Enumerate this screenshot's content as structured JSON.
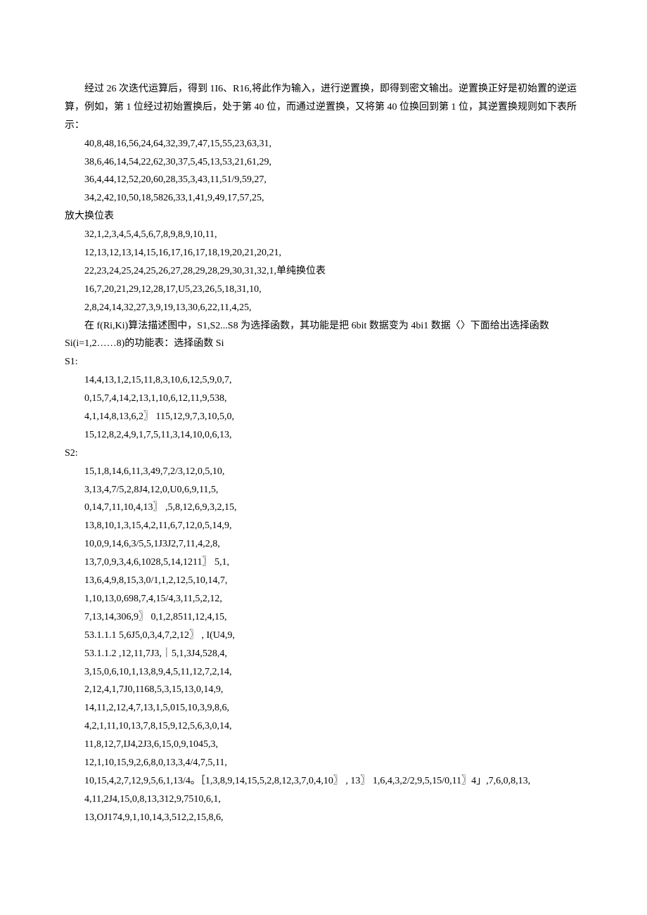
{
  "p1": "经过 26 次迭代运算后，得到 1I6、R16,将此作为输入，进行逆置换，即得到密文输出。逆置换正好是初始置的逆运算，例如，第 1 位经过初始置换后，处于第 40 位，而通过逆置换，又将第 40 位换回到第 1 位，其逆置换规则如下表所示：",
  "l1": "40,8,48,16,56,24,64,32,39,7,47,15,55,23,63,31,",
  "l2": "38,6,46,14,54,22,62,30,37,5,45,13,53,21,61,29,",
  "l3": "36,4,44,12,52,20,60,28,35,3,43,11,51/9,59,27,",
  "l4": "34,2,42,10,50,18,5826,33,1,41,9,49,17,57,25,",
  "h1": "放大换位表",
  "l5": "32,1,2,3,4,5,4,5,6,7,8,9,8,9,10,11,",
  "l6": "12,13,12,13,14,15,16,17,16,17,18,19,20,21,20,21,",
  "l7": "22,23,24,25,24,25,26,27,28,29,28,29,30,31,32,1,单纯换位表",
  "l8": "16,7,20,21,29,12,28,17,U5,23,26,5,18,31,10,",
  "l9": "2,8,24,14,32,27,3,9,19,13,30,6,22,11,4,25,",
  "p2": "在 f(Ri,Ki)算法描述图中，S1,S2...S8 为选择函数，其功能是把 6bit 数据变为 4bi1 数据〈〉下面给出选择函数 Si(i=1,2……8)的功能表：选择函数 Si",
  "hS1": "S1:",
  "s1a": "14,4,13,1,2,15,11,8,3,10,6,12,5,9,0,7,",
  "s1b": "0,15,7,4,14,2,13,1,10,6,12,11,9,538,",
  "s1c": "4,1,14,8,13,6,2〗 115,12,9,7,3,10,5,0,",
  "s1d": "15,12,8,2,4,9,1,7,5,11,3,14,10,0,6,13,",
  "hS2": "S2:",
  "s2a": "15,1,8,14,6,11,3,49,7,2/3,12,0,5,10,",
  "s2b": "3,13,4,7/5,2,8J4,12,0,U0,6,9,11,5,",
  "s2c": "0,14,7,11,10,4,13〗 ,5,8,12,6,9,3,2,15,",
  "s2d": "13,8,10,1,3,15,4,2,11,6,7,12,0,5,14,9,",
  "s2e": "10,0,9,14,6,3/5,5,1J3J2,7,11,4,2,8,",
  "s2f": "13,7,0,9,3,4,6,1028,5,14,1211〗 5,1,",
  "s2g": "13,6,4,9,8,15,3,0/1,1,2,12,5,10,14,7,",
  "s2h": "1,10,13,0,698,7,4,15/4,3,11,5,2,12,",
  "s2i": "7,13,14,306,9〗 0,1,2,8511,12,4,15,",
  "s2j": "53.1.1.1   5,6J5,0,3,4,7,2,12〗 , I(U4,9,",
  "s2k": "53.1.1.2   ,12,11,7J3,｜5,1,3J4,528,4,",
  "s2l": "3,15,0,6,10,1,13,8,9,4,5,11,12,7,2,14,",
  "s2m": "2,12,4,1,7J0,1168,5,3,15,13,0,14,9,",
  "s2n": "14,11,2,12,4,7,13,1,5,015,10,3,9,8,6,",
  "s2o": "4,2,1,11,10,13,7,8,15,9,12,5,6,3,0,14,",
  "s2p": "11,8,12,7,IJ4,2J3,6,15,0,9,1045,3,",
  "s2q": "12,1,10,15,9,2,6,8,0,13,3,4/4,7,5,11,",
  "s2r": "10,15,4,2,7,12,9,5,6,1,13/4。［1,3,8,9,14,15,5,2,8,12,3,7,0,4,10〗 , 13〗 1,6,4,3,2/2,9,5,15/0,11〗4」,7,6,0,8,13,",
  "s2s": "4,11,2J4,15,0,8,13,312,9,7510,6,1,",
  "s2t": "13,OJ174,9,1,10,14,3,512,2,15,8,6,"
}
